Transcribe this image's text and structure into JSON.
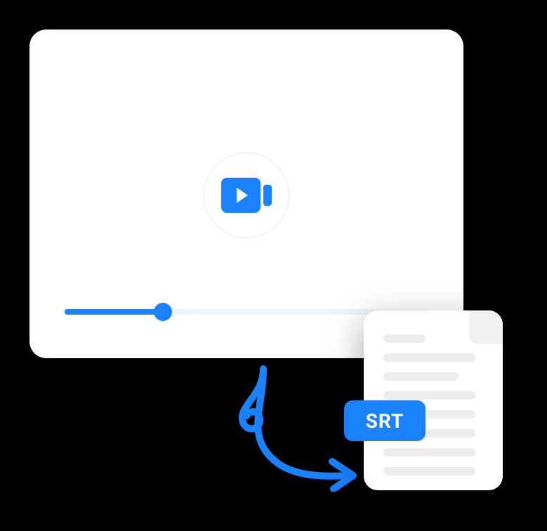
{
  "colors": {
    "primary": "#1a82ff",
    "background": "#000000",
    "card": "#ffffff",
    "line": "#ededed"
  },
  "video": {
    "progress_percent": 27
  },
  "file": {
    "badge_label": "SRT"
  }
}
